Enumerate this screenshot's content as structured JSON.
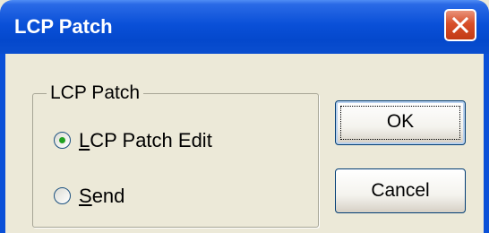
{
  "window": {
    "title": "LCP Patch"
  },
  "group": {
    "label": "LCP Patch"
  },
  "options": [
    {
      "accel": "L",
      "rest": "CP Patch Edit",
      "checked": true
    },
    {
      "accel": "S",
      "rest": "end",
      "checked": false
    }
  ],
  "buttons": {
    "ok": "OK",
    "cancel": "Cancel"
  },
  "icons": {
    "close": "close-icon",
    "radio_selected": "radio-selected-icon",
    "radio_unselected": "radio-unselected-icon"
  },
  "colors": {
    "titlebar": "#0a50d8",
    "close_button": "#d84f2a",
    "dialog_background": "#ece9d8",
    "radio_dot": "#21a121"
  }
}
